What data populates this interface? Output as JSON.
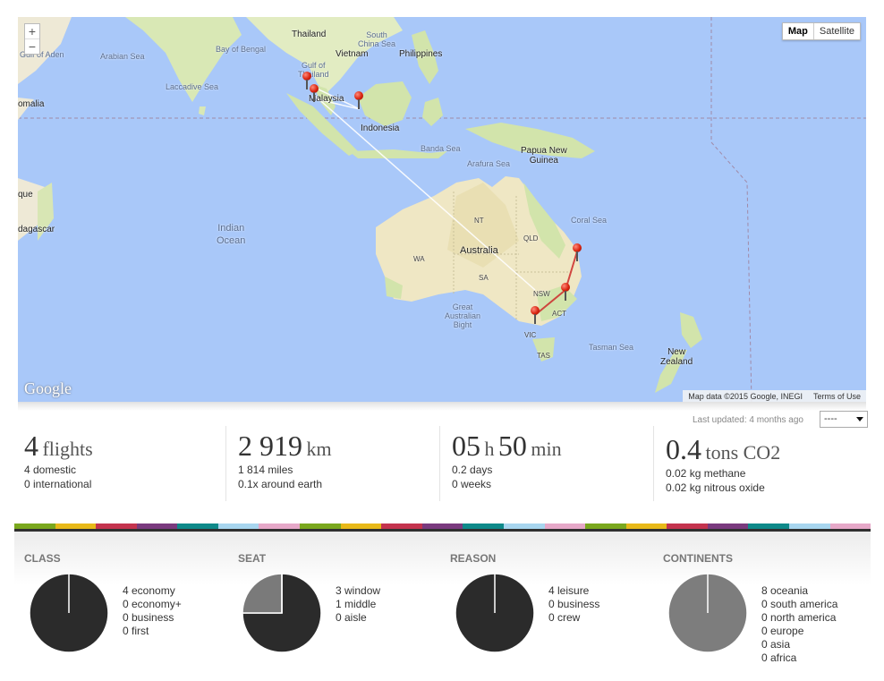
{
  "map": {
    "zoom_in": "+",
    "zoom_out": "−",
    "type_map": "Map",
    "type_satellite": "Satellite",
    "logo": "Google",
    "attribution": "Map data ©2015 Google, INEGI",
    "terms": "Terms of Use",
    "labels": {
      "thailand": "Thailand",
      "south_china_sea": "South\nChina Sea",
      "vietnam": "Vietnam",
      "philippines": "Philippines",
      "gulf_of_aden": "Gulf of Aden",
      "arabian_sea": "Arabian Sea",
      "bay_of_bengal": "Bay of Bengal",
      "gulf_of_thailand": "Gulf of\nThailand",
      "laccadive_sea": "Laccadive Sea",
      "malaysia": "Malaysia",
      "somalia": "omalia",
      "indonesia": "Indonesia",
      "banda_sea": "Banda Sea",
      "papua_new_guinea": "Papua New\nGuinea",
      "arafura_sea": "Arafura Sea",
      "mozambique": "que",
      "coral_sea": "Coral Sea",
      "nt": "NT",
      "madagascar": "dagascar",
      "indian_ocean": "Indian\nOcean",
      "qld": "QLD",
      "australia": "Australia",
      "wa": "WA",
      "sa": "SA",
      "nsw": "NSW",
      "great_australian_bight": "Great\nAustralian\nBight",
      "act": "ACT",
      "vic": "VIC",
      "tasman_sea": "Tasman Sea",
      "new_zealand": "New\nZealand",
      "tas": "TAS"
    }
  },
  "header": {
    "last_updated": "Last updated: 4 months ago",
    "filter_value": "----"
  },
  "stats": {
    "flights": {
      "value": "4",
      "unit": "flights",
      "line1": "4 domestic",
      "line2": "0 international"
    },
    "distance": {
      "value": "2 919",
      "unit": "km",
      "line1": "1 814 miles",
      "line2": "0.1x around earth"
    },
    "duration": {
      "hours": "05",
      "h": "h",
      "minutes": "50",
      "min": "min",
      "line1": "0.2 days",
      "line2": "0 weeks"
    },
    "co2": {
      "value": "0.4",
      "unit": "tons CO2",
      "line1": "0.02 kg methane",
      "line2": "0.02 kg nitrous oxide"
    }
  },
  "stripe_colors": [
    "#7aa81e",
    "#e8b919",
    "#c4334e",
    "#7a3a7e",
    "#0f8a8a",
    "#a8d6ef",
    "#e6a8c8",
    "#7aa81e",
    "#e8b919",
    "#c4334e",
    "#7a3a7e",
    "#0f8a8a",
    "#a8d6ef",
    "#e6a8c8",
    "#7aa81e",
    "#e8b919",
    "#c4334e",
    "#7a3a7e",
    "#0f8a8a",
    "#a8d6ef",
    "#e6a8c8"
  ],
  "chart_data": [
    {
      "type": "pie",
      "title": "CLASS",
      "categories": [
        "economy",
        "economy+",
        "business",
        "first"
      ],
      "values": [
        4,
        0,
        0,
        0
      ],
      "legend": [
        "4 economy",
        "0 economy+",
        "0 business",
        "0 first"
      ]
    },
    {
      "type": "pie",
      "title": "SEAT",
      "categories": [
        "window",
        "middle",
        "aisle"
      ],
      "values": [
        3,
        1,
        0
      ],
      "legend": [
        "3 window",
        "1 middle",
        "0 aisle"
      ]
    },
    {
      "type": "pie",
      "title": "REASON",
      "categories": [
        "leisure",
        "business",
        "crew"
      ],
      "values": [
        4,
        0,
        0
      ],
      "legend": [
        "4 leisure",
        "0 business",
        "0 crew"
      ]
    },
    {
      "type": "pie",
      "title": "CONTINENTS",
      "categories": [
        "oceania",
        "south america",
        "north america",
        "europe",
        "asia",
        "africa"
      ],
      "values": [
        8,
        0,
        0,
        0,
        0,
        0
      ],
      "legend": [
        "8 oceania",
        "0 south america",
        "0 north america",
        "0 europe",
        "0 asia",
        "0 africa"
      ]
    }
  ]
}
